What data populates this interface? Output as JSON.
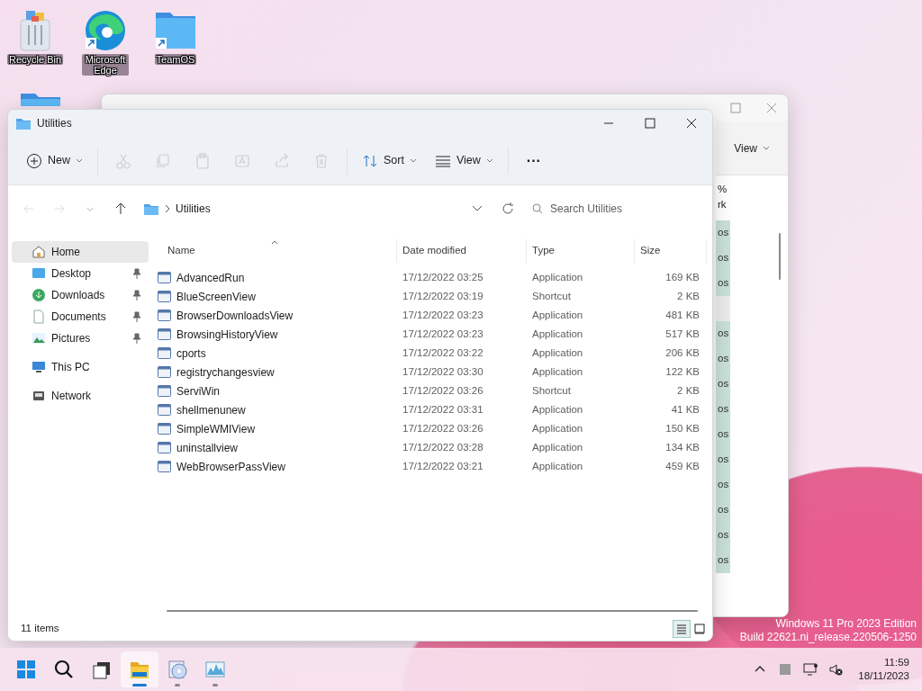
{
  "desktop_icons": [
    {
      "kind": "recycle-bin",
      "label": "Recycle Bin",
      "shortcut": false
    },
    {
      "kind": "browser",
      "label": "Microsoft Edge",
      "shortcut": true
    },
    {
      "kind": "folder",
      "label": "TeamOS",
      "shortcut": true
    },
    {
      "kind": "folder"
    }
  ],
  "back_window": {
    "toolbar_button": "View",
    "header_fragments": [
      "%",
      "rk"
    ],
    "rows": [
      {
        "kind": "row",
        "text": "os",
        "selected": true
      },
      {
        "kind": "row",
        "text": "os",
        "selected": true
      },
      {
        "kind": "row",
        "text": "os",
        "selected": true
      },
      {
        "kind": "group",
        "selected": false
      },
      {
        "kind": "row",
        "text": "os",
        "selected": true
      },
      {
        "kind": "row",
        "text": "os",
        "selected": true
      },
      {
        "kind": "row",
        "text": "os",
        "selected": true
      },
      {
        "kind": "row",
        "text": "os",
        "selected": true
      },
      {
        "kind": "row",
        "text": "os",
        "selected": true
      },
      {
        "kind": "row",
        "text": "os",
        "selected": true
      },
      {
        "kind": "row",
        "text": "os",
        "selected": true
      },
      {
        "kind": "row",
        "text": "os",
        "selected": true
      },
      {
        "kind": "row",
        "text": "os",
        "selected": true
      },
      {
        "kind": "row",
        "text": "os",
        "selected": true
      }
    ]
  },
  "window": {
    "title": "Utilities",
    "toolbar": [
      {
        "kind": "new",
        "label": "New",
        "disabled": false
      },
      {
        "kind": "cut",
        "disabled": true
      },
      {
        "kind": "copy",
        "disabled": true
      },
      {
        "kind": "paste",
        "disabled": true
      },
      {
        "kind": "rename",
        "disabled": true
      },
      {
        "kind": "share",
        "disabled": true
      },
      {
        "kind": "delete",
        "disabled": true
      },
      {
        "kind": "sort",
        "label": "Sort",
        "disabled": false
      },
      {
        "kind": "view",
        "label": "View",
        "disabled": false
      },
      {
        "kind": "more",
        "label": "···",
        "disabled": false
      }
    ],
    "breadcrumb": [
      "Utilities"
    ],
    "search": {
      "placeholder": "Search Utilities"
    },
    "nav_sections": [
      {
        "items": [
          {
            "kind": "home",
            "label": "Home",
            "selected": true,
            "pinned": false
          },
          {
            "kind": "desktop",
            "label": "Desktop",
            "selected": false,
            "pinned": true
          },
          {
            "kind": "downloads",
            "label": "Downloads",
            "selected": false,
            "pinned": true
          },
          {
            "kind": "documents",
            "label": "Documents",
            "selected": false,
            "pinned": true
          },
          {
            "kind": "pictures",
            "label": "Pictures",
            "selected": false,
            "pinned": true
          }
        ]
      },
      {
        "items": [
          {
            "kind": "pc",
            "label": "This PC",
            "selected": false,
            "pinned": false
          }
        ]
      },
      {
        "items": [
          {
            "kind": "network",
            "label": "Network",
            "selected": false,
            "pinned": false
          }
        ]
      }
    ],
    "columns": [
      {
        "label": "Name",
        "sorted": true
      },
      {
        "label": "Date modified",
        "sorted": false
      },
      {
        "label": "Type",
        "sorted": false
      },
      {
        "label": "Size",
        "sorted": false
      }
    ],
    "rows": [
      [
        "AdvancedRun",
        "17/12/2022 03:25",
        "Application",
        "169 KB"
      ],
      [
        "BlueScreenView",
        "17/12/2022 03:19",
        "Shortcut",
        "2 KB"
      ],
      [
        "BrowserDownloadsView",
        "17/12/2022 03:23",
        "Application",
        "481 KB"
      ],
      [
        "BrowsingHistoryView",
        "17/12/2022 03:23",
        "Application",
        "517 KB"
      ],
      [
        "cports",
        "17/12/2022 03:22",
        "Application",
        "206 KB"
      ],
      [
        "registrychangesview",
        "17/12/2022 03:30",
        "Application",
        "122 KB"
      ],
      [
        "ServiWin",
        "17/12/2022 03:26",
        "Shortcut",
        "2 KB"
      ],
      [
        "shellmenunew",
        "17/12/2022 03:31",
        "Application",
        "41 KB"
      ],
      [
        "SimpleWMIView",
        "17/12/2022 03:26",
        "Application",
        "150 KB"
      ],
      [
        "uninstallview",
        "17/12/2022 03:28",
        "Application",
        "134 KB"
      ],
      [
        "WebBrowserPassView",
        "17/12/2022 03:21",
        "Application",
        "459 KB"
      ]
    ],
    "status": "11 items",
    "view_modes": [
      {
        "kind": "details",
        "selected": true
      },
      {
        "kind": "tiles",
        "selected": false
      }
    ]
  },
  "watermark_lines": [
    "Windows 11 Pro 2023 Edition",
    "Build 22621.ni_release.220506-1250"
  ],
  "taskbar": {
    "apps": [
      {
        "kind": "start",
        "active": false,
        "running": false
      },
      {
        "kind": "search",
        "active": false,
        "running": false
      },
      {
        "kind": "taskview",
        "active": false,
        "running": false
      },
      {
        "kind": "explorer",
        "active": true,
        "running": true
      },
      {
        "kind": "disc",
        "active": false,
        "running": true
      },
      {
        "kind": "monitor",
        "active": false,
        "running": true
      }
    ],
    "tray": [
      {
        "kind": "chevron"
      },
      {
        "kind": "app"
      },
      {
        "kind": "network"
      },
      {
        "kind": "muted"
      }
    ],
    "time": "11:59",
    "date": "18/11/2023"
  }
}
